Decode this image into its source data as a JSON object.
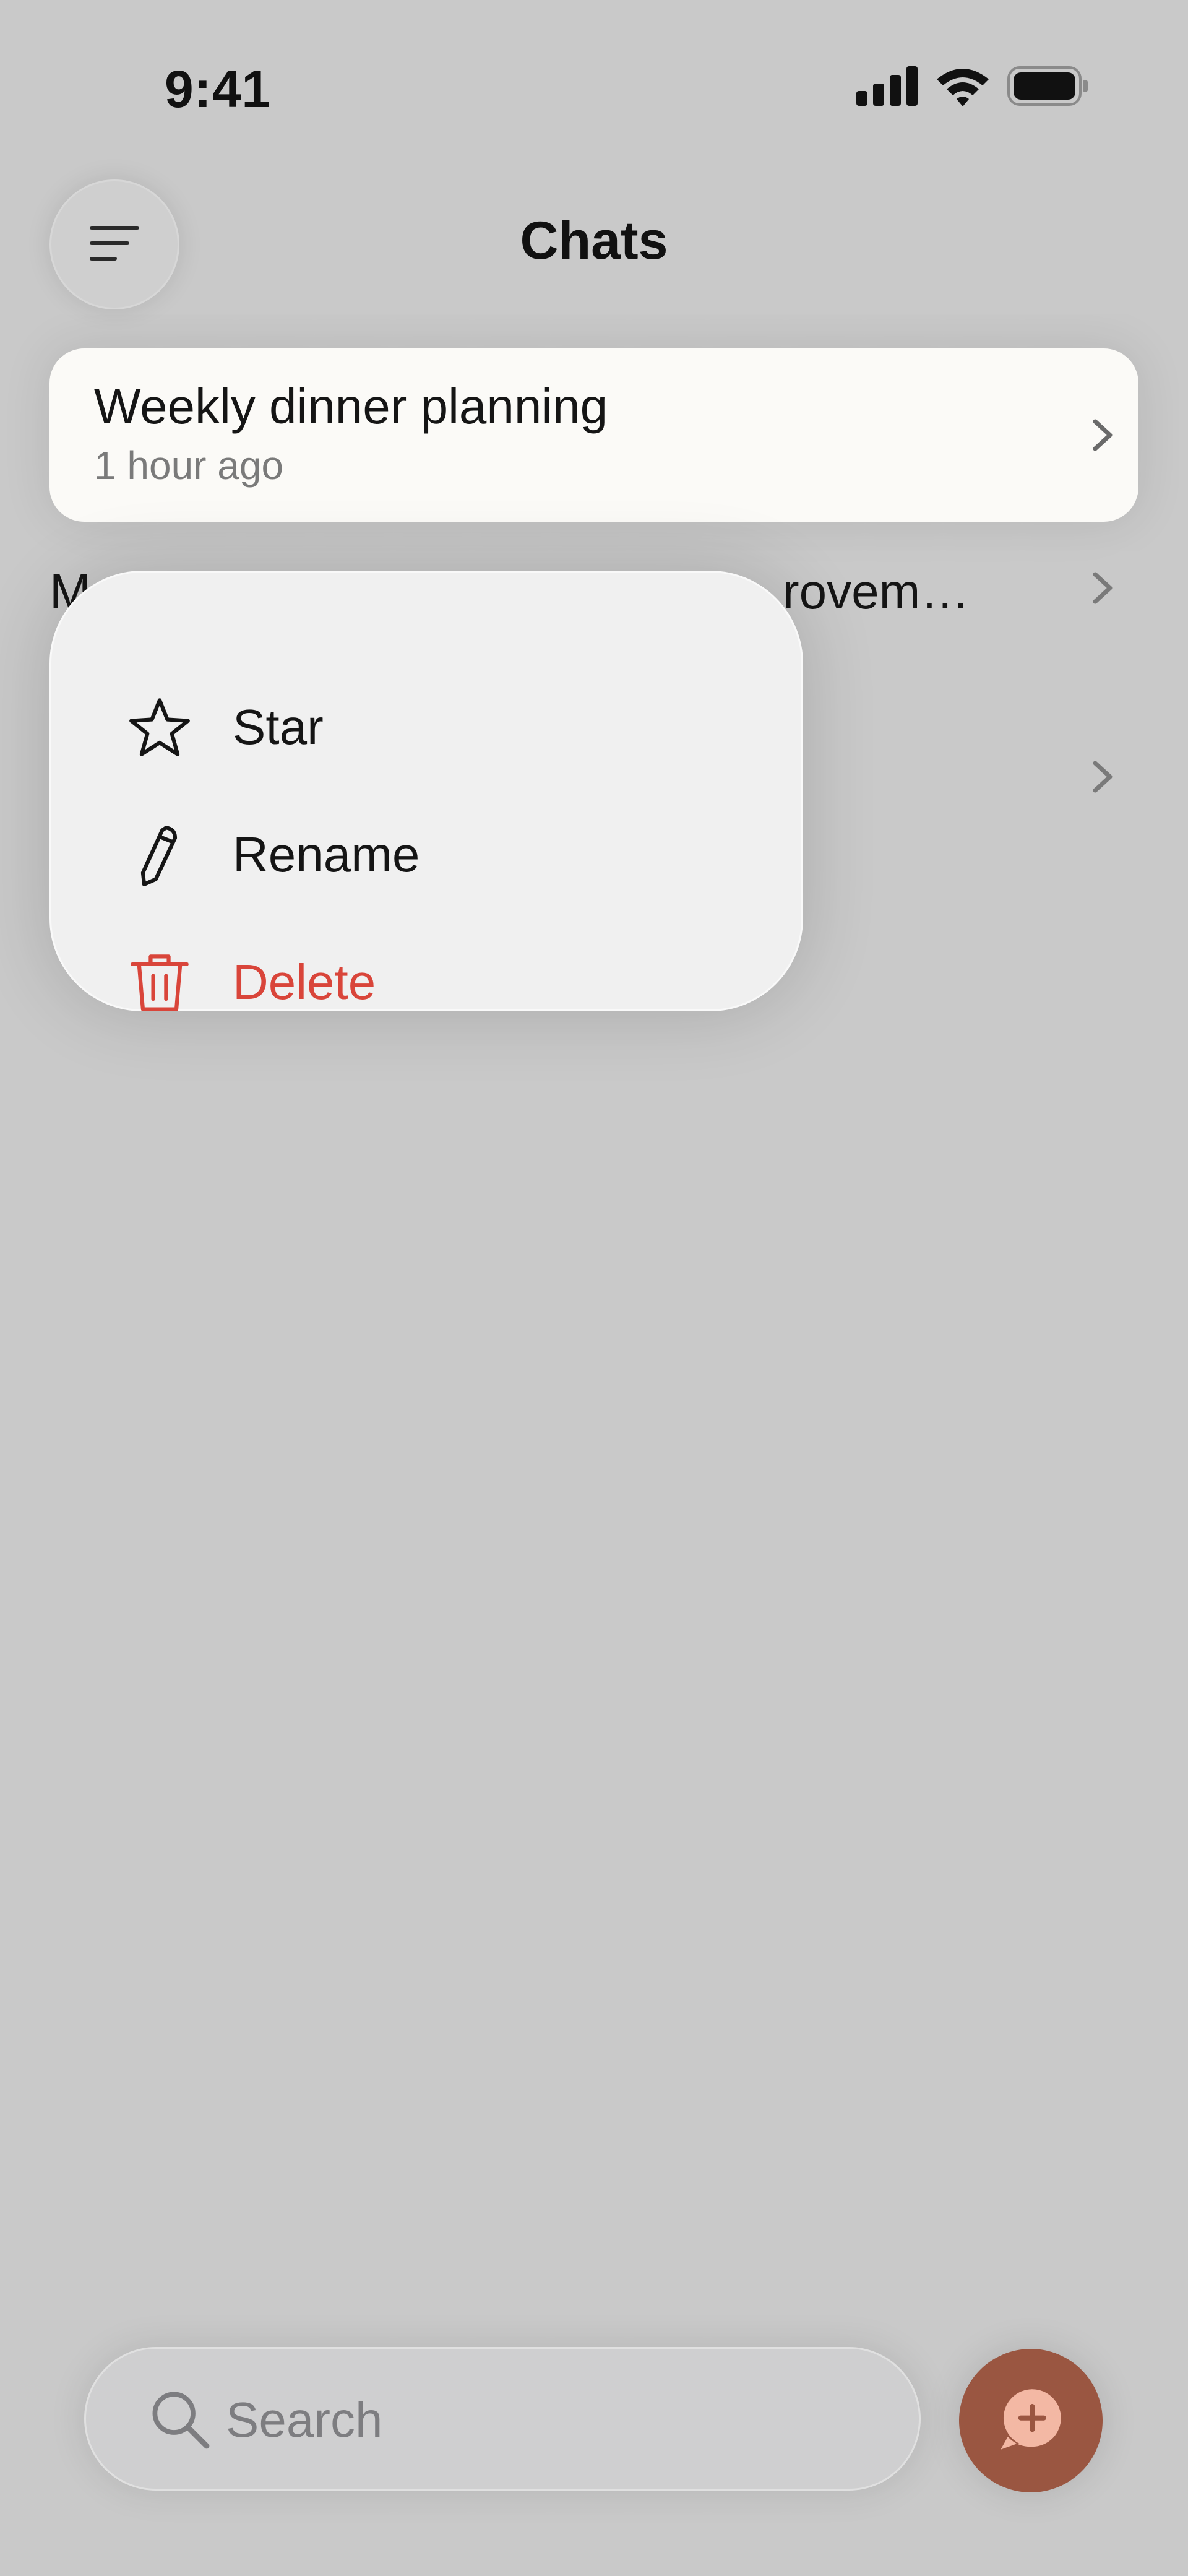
{
  "status_bar": {
    "time": "9:41",
    "icons": [
      "cellular-signal-icon",
      "wifi-icon",
      "battery-icon"
    ]
  },
  "header": {
    "title": "Chats",
    "menu_icon": "hamburger-menu-icon"
  },
  "chats": [
    {
      "title": "Weekly dinner planning",
      "time": "1 hour ago",
      "selected": true
    },
    {
      "title": "M",
      "title_tail": "rovem…",
      "time": ""
    },
    {
      "title": "",
      "time": ""
    }
  ],
  "context_menu": {
    "items": [
      {
        "label": "Star",
        "icon": "star-icon",
        "destructive": false
      },
      {
        "label": "Rename",
        "icon": "pencil-icon",
        "destructive": false
      },
      {
        "label": "Delete",
        "icon": "trash-icon",
        "destructive": true
      }
    ]
  },
  "search": {
    "placeholder": "Search",
    "value": ""
  },
  "new_chat_button": {
    "icon": "new-chat-icon"
  },
  "colors": {
    "background": "#c9c9c9",
    "card": "#fbfaf7",
    "menu": "#f0f0f0",
    "destructive": "#d9453a",
    "accent": "#9a5641"
  }
}
